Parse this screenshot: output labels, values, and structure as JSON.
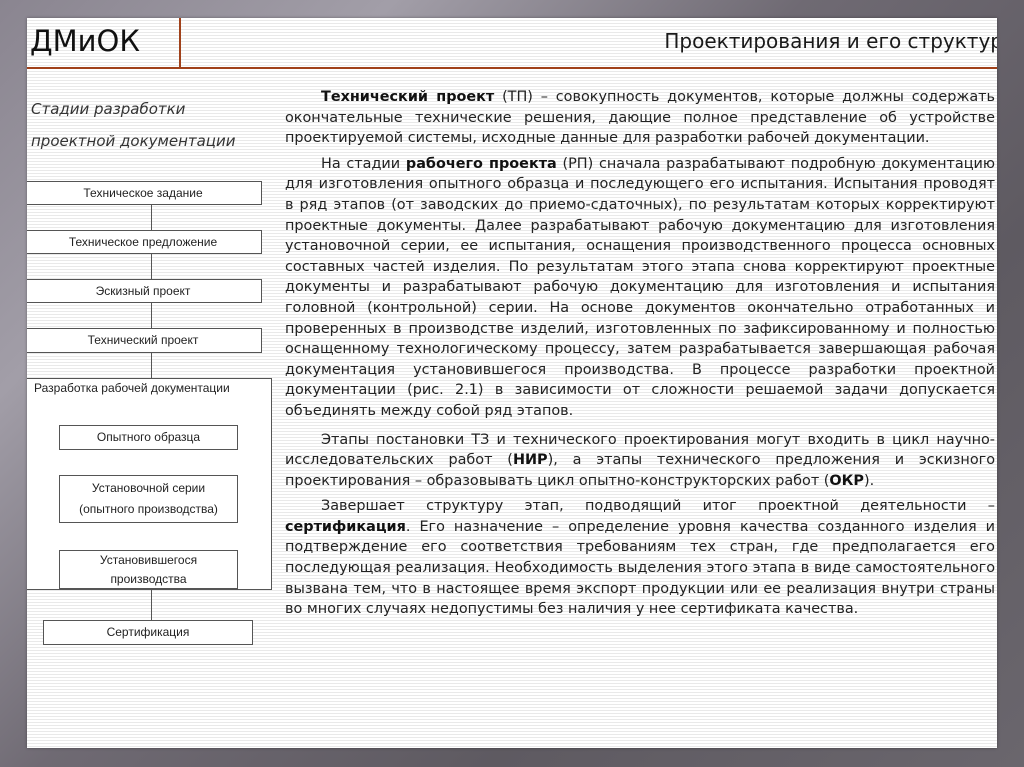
{
  "header": {
    "brand": "ДМиОК",
    "title": "Проектирования и его структур"
  },
  "diagram": {
    "title_line1": "Стадии разработки",
    "title_line2": "проектной документации",
    "stages": [
      "Техническое задание",
      "Техническое предложение",
      "Эскизный проект",
      "Технический проект"
    ],
    "group": {
      "label": "Разработка рабочей документации",
      "items": [
        "Опытного образца",
        "Установочной серии (опытного производства)",
        "Установившегося производства"
      ]
    },
    "final_stage": "Сертификация"
  },
  "body": {
    "p1": {
      "bold": "Технический проект",
      "text": " (ТП) – совокупность документов, которые должны содержать окончательные технические решения, дающие полное представление об устройстве проектируемой системы, исходные данные для разработки рабочей документации."
    },
    "p2": {
      "pre": "На стадии ",
      "bold": "рабочего проекта",
      "text": " (РП) сначала разрабатывают подробную документацию для изготовления опытного образца и последующего его испытания. Испытания проводят в ряд этапов (от заводских до приемо-сдаточных), по результатам которых корректируют проектные документы. Далее разрабатывают рабочую документацию для изготовления установочной серии, ее испытания, оснащения производственного процесса основных составных частей изделия. По результатам этого этапа снова корректируют проектные документы и разрабатывают рабочую документацию для изготовления и испытания головной (контрольной) серии. На основе документов окончательно отработанных и проверенных в производстве изделий, изготовленных по зафиксированному и полностью оснащенному технологическому процессу, затем разрабатывается завершающая рабочая документация установившегося производства. В процессе разработки проектной документации (рис. 2.1) в зависимости от сложности решаемой задачи допускается объединять между собой ряд этапов."
    },
    "p3": {
      "pre": "Этапы постановки ТЗ и технического проектирования могут входить в цикл научно-исследовательских работ (",
      "bold1": "НИР",
      "mid": "), а этапы технического предложения и эскизного проектирования – образовывать цикл опытно-конструкторских работ (",
      "bold2": "ОКР",
      "post": ")."
    },
    "p4": {
      "pre": "Завершает структуру этап, подводящий итог проектной деятельности – ",
      "bold": "сертификация",
      "text": ". Его назначение – определение уровня качества созданного изделия и подтверждение его соответствия требованиям тех стран, где предполагается его последующая реализация. Необходимость выделения этого этапа в виде самостоятельного вызвана тем, что в настоящее время экспорт продукции или ее реализация внутри страны во многих случаях недопустимы без наличия у нее сертификата качества."
    }
  },
  "colors": {
    "accent_rule": "#a0411a",
    "frame": "#6f6a73",
    "text": "#222222"
  }
}
